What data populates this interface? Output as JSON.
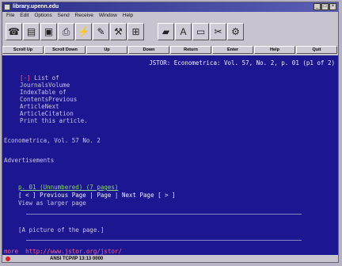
{
  "window": {
    "title": "library.upenn.edu"
  },
  "menu": [
    "File",
    "Edit",
    "Options",
    "Send",
    "Receive",
    "Window",
    "Help"
  ],
  "buttons": [
    "Scroll Up",
    "Scroll Down",
    "Up",
    "Down",
    "Return",
    "Enter",
    "Help",
    "Quit"
  ],
  "terminal": {
    "header": "JSTOR: Econometrica: Vol. 57, No. 2, p. 01 (p1 of 2)",
    "marker": "[-]",
    "list_of": "List of",
    "links": [
      "JournalsVolume",
      "IndexTable of",
      "ContentsPrevious",
      "ArticleNext",
      "ArticleCitation",
      "Print this article."
    ],
    "journal": "Econometrica, Vol. 57 No. 2",
    "ads": "Advertisements",
    "page_link": "p. 01 (Unnumbered) (7 pages)",
    "nav": "[ < ] Previous Page | Page | Next Page [ > ]",
    "view_larger": "View as larger page",
    "picture": "[A picture of the page.]",
    "url": "more  http://www.jstor.org/jstor/"
  },
  "status": {
    "text": "ANSI TCP/IP 13:13 0000"
  }
}
